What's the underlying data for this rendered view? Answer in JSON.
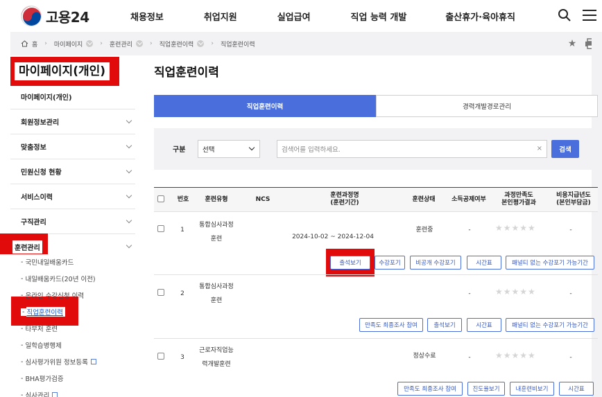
{
  "header": {
    "logo_text": "고용24",
    "nav": [
      "채용정보",
      "취업지원",
      "실업급여",
      "직업 능력 개발",
      "출산휴가·육아휴직"
    ]
  },
  "breadcrumb": [
    "홈",
    "마이페이지",
    "훈련관리",
    "직업훈련이력",
    "직업훈련이력"
  ],
  "sidebar": {
    "title": "마이페이지(개인)",
    "items": [
      {
        "label": "마이페이지(개인)",
        "chevron": false
      },
      {
        "label": "회원정보관리",
        "chevron": true
      },
      {
        "label": "맞춤정보",
        "chevron": true
      },
      {
        "label": "민원신청 현황",
        "chevron": true
      },
      {
        "label": "서비스이력",
        "chevron": true
      },
      {
        "label": "구직관리",
        "chevron": true
      },
      {
        "label": "훈련관리",
        "chevron": true
      }
    ],
    "sub_items": [
      {
        "label": "국민내일배움카드",
        "ext": false
      },
      {
        "label": "내일배움카드(20년 이전)",
        "ext": false
      },
      {
        "label": "온라인 수강신청 이력",
        "ext": false
      },
      {
        "label": "직업훈련이력",
        "ext": false
      },
      {
        "label": "타부처 훈련",
        "ext": false
      },
      {
        "label": "일학습병행제",
        "ext": false
      },
      {
        "label": "심사평가위원 정보등록",
        "ext": true
      },
      {
        "label": "BHA평가검증",
        "ext": false
      },
      {
        "label": "심사관리",
        "ext": true
      }
    ]
  },
  "main": {
    "title": "직업훈련이력",
    "tabs": [
      "직업훈련이력",
      "경력개발경로관리"
    ],
    "search": {
      "label": "구분",
      "select_value": "선택",
      "placeholder": "검색어를 입력하세요.",
      "button": "검색"
    },
    "table": {
      "headers": [
        "번호",
        "훈련유형",
        "NCS",
        "훈련과정명\n(훈련기간)",
        "훈련상태",
        "소득공제여부",
        "과정만족도\n본인평가결과",
        "비용지급년도\n(본인부담금)"
      ],
      "rows": [
        {
          "no": "1",
          "type1": "통합심사과정",
          "type2": "훈련",
          "ncs": "",
          "period": "2024-10-02 ~ 2024-12-04",
          "status": "훈련중",
          "tax": "-",
          "cost": "-",
          "buttons": [
            "출석보기",
            "수강포기",
            "비공개 수강포기",
            "시간표",
            "패널티 없는 수강포기 가능기간"
          ]
        },
        {
          "no": "2",
          "type1": "통합심사과정",
          "type2": "훈련",
          "ncs": "",
          "period": "",
          "status": "",
          "tax": "-",
          "cost": "-",
          "buttons": [
            "만족도 최종조사 참여",
            "출석보기",
            "시간표",
            "패널티 없는 수강포기 가능기간"
          ]
        },
        {
          "no": "3",
          "type1": "근로자직업능",
          "type2": "력개발훈련",
          "ncs": "",
          "period": "",
          "status": "정상수료",
          "tax": "-",
          "cost": "-",
          "buttons": [
            "만족도 최종조사 참여",
            "진도율보기",
            "내훈련비보기",
            "시간표"
          ]
        }
      ]
    }
  },
  "colors": {
    "accent": "#4a6fdc",
    "highlight": "#e20b0b"
  }
}
